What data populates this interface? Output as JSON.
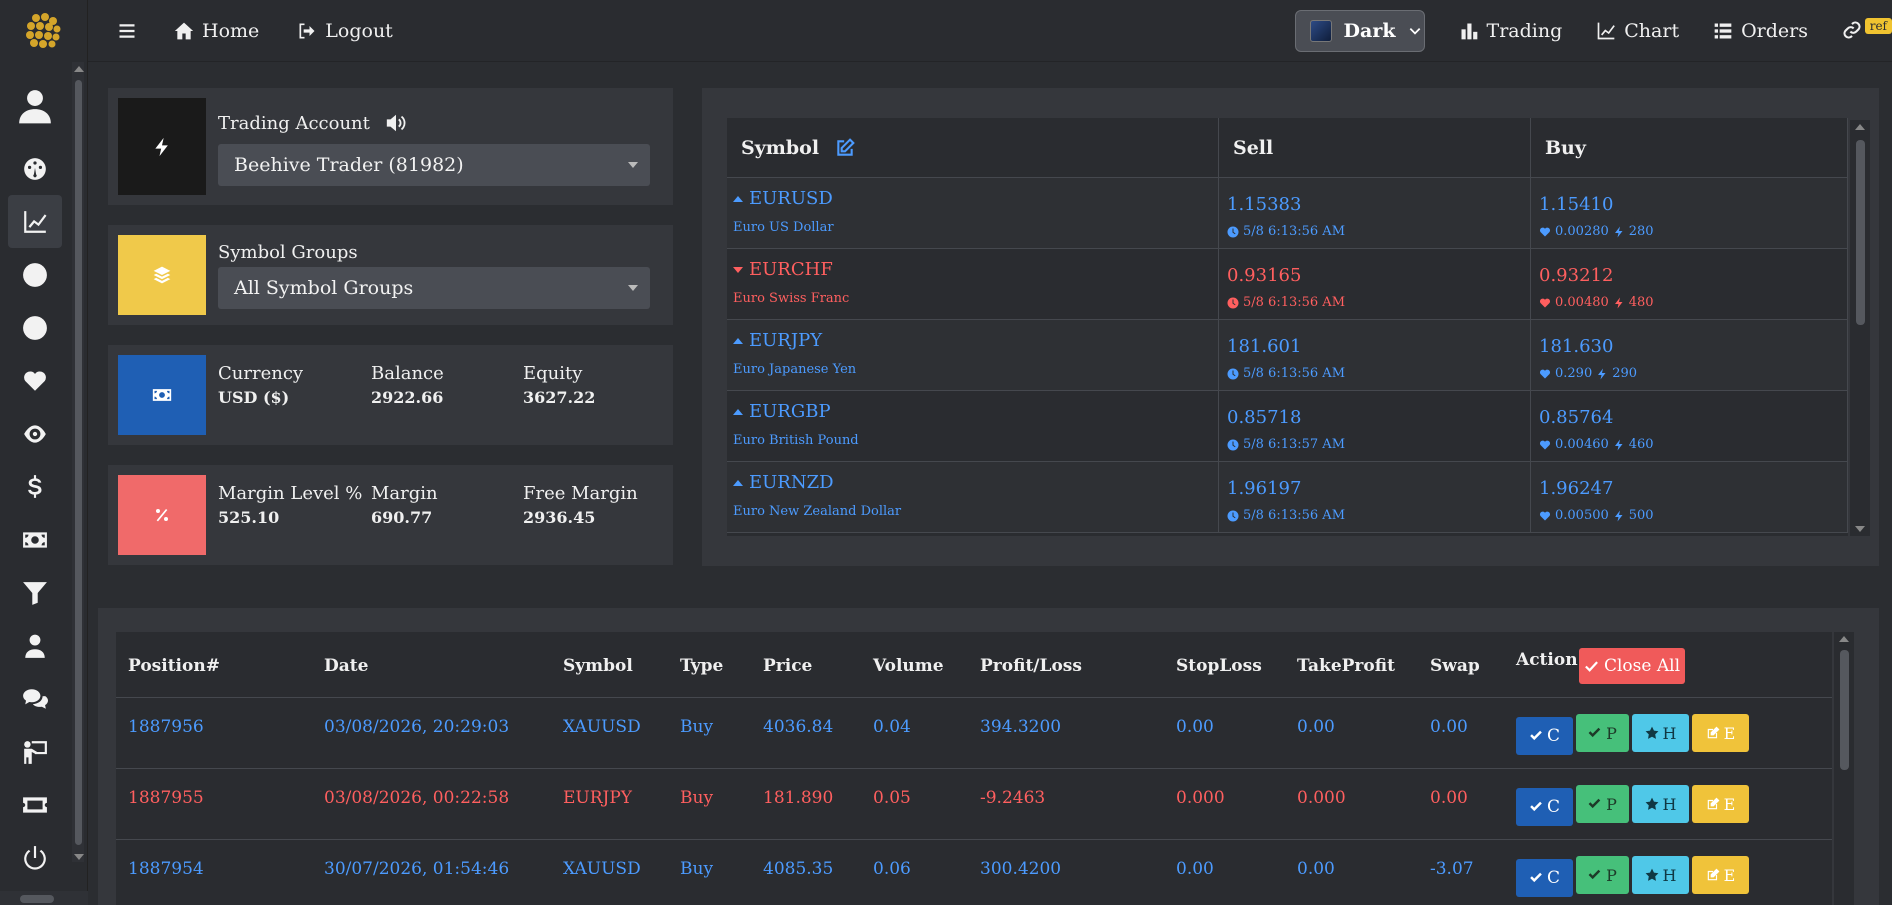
{
  "nav": {
    "home": "Home",
    "logout": "Logout",
    "theme": "Dark",
    "trading": "Trading",
    "chart": "Chart",
    "orders": "Orders",
    "ref": "ref"
  },
  "sidebar": {
    "items": [
      "user-icon",
      "dashboard-icon",
      "chart-line-icon",
      "circle-icon",
      "circle-icon",
      "heart-icon",
      "eye-icon",
      "dollar-icon",
      "money-icon",
      "filter-icon",
      "person-icon",
      "comments-icon",
      "presenter-icon",
      "ticket-icon",
      "power-icon"
    ]
  },
  "account": {
    "title": "Trading Account",
    "selected": "Beehive Trader (81982)"
  },
  "groups": {
    "title": "Symbol Groups",
    "selected": "All Symbol Groups"
  },
  "currency": {
    "label": "Currency",
    "value": "USD ($)",
    "balance_label": "Balance",
    "balance": "2922.66",
    "equity_label": "Equity",
    "equity": "3627.22"
  },
  "margin": {
    "level_label": "Margin Level %",
    "level": "525.10",
    "margin_label": "Margin",
    "margin": "690.77",
    "free_label": "Free Margin",
    "free": "2936.45"
  },
  "symbols": {
    "headers": {
      "symbol": "Symbol",
      "sell": "Sell",
      "buy": "Buy"
    },
    "rows": [
      {
        "sym": "EURUSD",
        "desc": "Euro US Dollar",
        "sell": "1.15383",
        "time": "5/8 6:13:56 AM",
        "buy": "1.15410",
        "spread": "0.00280",
        "pts": "280",
        "dir": "up"
      },
      {
        "sym": "EURCHF",
        "desc": "Euro Swiss Franc",
        "sell": "0.93165",
        "time": "5/8 6:13:56 AM",
        "buy": "0.93212",
        "spread": "0.00480",
        "pts": "480",
        "dir": "down"
      },
      {
        "sym": "EURJPY",
        "desc": "Euro Japanese Yen",
        "sell": "181.601",
        "time": "5/8 6:13:56 AM",
        "buy": "181.630",
        "spread": "0.290",
        "pts": "290",
        "dir": "up"
      },
      {
        "sym": "EURGBP",
        "desc": "Euro British Pound",
        "sell": "0.85718",
        "time": "5/8 6:13:57 AM",
        "buy": "0.85764",
        "spread": "0.00460",
        "pts": "460",
        "dir": "up"
      },
      {
        "sym": "EURNZD",
        "desc": "Euro New Zealand Dollar",
        "sell": "1.96197",
        "time": "5/8 6:13:56 AM",
        "buy": "1.96247",
        "spread": "0.00500",
        "pts": "500",
        "dir": "up"
      }
    ]
  },
  "positions": {
    "headers": {
      "pos": "Position#",
      "date": "Date",
      "symbol": "Symbol",
      "type": "Type",
      "price": "Price",
      "volume": "Volume",
      "pl": "Profit/Loss",
      "sl": "StopLoss",
      "tp": "TakeProfit",
      "swap": "Swap",
      "action": "Action"
    },
    "close_all": "Close All",
    "actions": {
      "c": "C",
      "p": "P",
      "h": "H",
      "e": "E"
    },
    "rows": [
      {
        "pos": "1887956",
        "date": "03/08/2026, 20:29:03",
        "symbol": "XAUUSD",
        "type": "Buy",
        "price": "4036.84",
        "volume": "0.04",
        "pl": "394.3200",
        "sl": "0.00",
        "tp": "0.00",
        "swap": "0.00",
        "status": "profit"
      },
      {
        "pos": "1887955",
        "date": "03/08/2026, 00:22:58",
        "symbol": "EURJPY",
        "type": "Buy",
        "price": "181.890",
        "volume": "0.05",
        "pl": "-9.2463",
        "sl": "0.000",
        "tp": "0.000",
        "swap": "0.00",
        "status": "loss"
      },
      {
        "pos": "1887954",
        "date": "30/07/2026, 01:54:46",
        "symbol": "XAUUSD",
        "type": "Buy",
        "price": "4085.35",
        "volume": "0.06",
        "pl": "300.4200",
        "sl": "0.00",
        "tp": "0.00",
        "swap": "-3.07",
        "status": "profit"
      }
    ]
  },
  "colors": {
    "accent_blue": "#4c9bff",
    "loss_red": "#ff5f5f",
    "account_box": "#1a1a1a",
    "groups_box": "#f0c94a",
    "currency_box": "#1f5fb4",
    "margin_box": "#f06a6a"
  }
}
